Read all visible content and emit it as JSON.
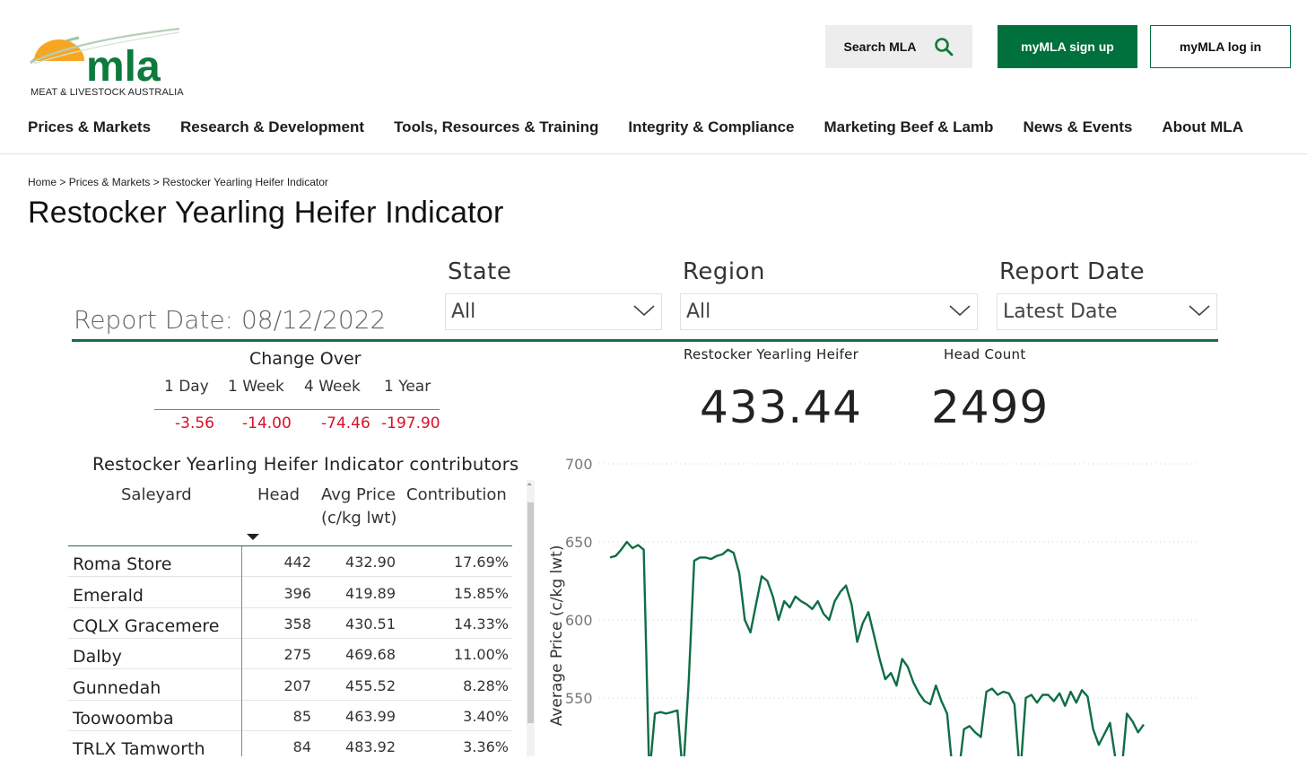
{
  "header": {
    "logo_text": "mla",
    "logo_tagline": "MEAT & LIVESTOCK AUSTRALIA",
    "search_label": "Search MLA",
    "signup_label": "myMLA sign up",
    "login_label": "myMLA log in",
    "colors": {
      "brand_green": "#00703c",
      "logo_orange": "#f6a623"
    }
  },
  "nav": {
    "items": [
      "Prices & Markets",
      "Research & Development",
      "Tools, Resources & Training",
      "Integrity & Compliance",
      "Marketing Beef & Lamb",
      "News & Events",
      "About MLA"
    ]
  },
  "breadcrumb": {
    "home": "Home",
    "sep": ">",
    "section": "Prices & Markets",
    "current": "Restocker Yearling Heifer Indicator"
  },
  "page_title": "Restocker Yearling Heifer Indicator",
  "report": {
    "report_date": "Report Date: 08/12/2022",
    "filters": [
      {
        "label": "State",
        "value": "All"
      },
      {
        "label": "Region",
        "value": "All"
      },
      {
        "label": "Report Date",
        "value": "Latest Date"
      }
    ],
    "change": {
      "title": "Change Over",
      "periods": [
        "1 Day",
        "1 Week",
        "4 Week",
        "1 Year"
      ],
      "values": [
        "-3.56",
        "-14.00",
        "-74.46",
        "-197.90"
      ],
      "negative_color": "#d8102a"
    },
    "kpis": [
      {
        "label": "Restocker Yearling Heifer",
        "value": "433.44"
      },
      {
        "label": "Head Count",
        "value": "2499"
      }
    ]
  },
  "contributors": {
    "title": "Restocker Yearling Heifer Indicator contributors",
    "columns": [
      "Saleyard",
      "Head",
      "Avg Price",
      "(c/kg lwt)",
      "Contribution"
    ],
    "rows": [
      [
        "Roma Store",
        "442",
        "432.90",
        "17.69%"
      ],
      [
        "Emerald",
        "396",
        "419.89",
        "15.85%"
      ],
      [
        "CQLX Gracemere",
        "358",
        "430.51",
        "14.33%"
      ],
      [
        "Dalby",
        "275",
        "469.68",
        "11.00%"
      ],
      [
        "Gunnedah",
        "207",
        "455.52",
        "8.28%"
      ],
      [
        "Toowoomba",
        "85",
        "463.99",
        "3.40%"
      ],
      [
        "TRLX Tamworth",
        "84",
        "483.92",
        "3.36%"
      ]
    ]
  },
  "chart_data": {
    "type": "line",
    "ylabel": "Average Price (c/kg lwt)",
    "y_ticks": [
      "700",
      "650",
      "600",
      "550"
    ],
    "ylim": [
      495,
      700
    ],
    "grid": true,
    "line_color": "#0f6e44",
    "series": [
      {
        "x": [
          0,
          2,
          4,
          6,
          8,
          10,
          12,
          14,
          16,
          18,
          20,
          22,
          24,
          26,
          28,
          30,
          32,
          34,
          36,
          38,
          40,
          42,
          44,
          46,
          48,
          50,
          52,
          54,
          56,
          58,
          60,
          62,
          64,
          66,
          68,
          70,
          72,
          74,
          76,
          78,
          80,
          82,
          84,
          86,
          88,
          90,
          92,
          94,
          96,
          98,
          100,
          102,
          104,
          106,
          108,
          110,
          112,
          114,
          116,
          118,
          120,
          122,
          124,
          126,
          128,
          130,
          132,
          134,
          136,
          138,
          140,
          142,
          144,
          146,
          148,
          150,
          152,
          154,
          156,
          158,
          160,
          162,
          164,
          166,
          168,
          170,
          172,
          174,
          176,
          178,
          180,
          182,
          184,
          186,
          188,
          190
        ],
        "y": [
          640,
          641,
          645,
          650,
          646,
          648,
          645,
          500,
          540,
          541,
          540,
          541,
          542,
          500,
          560,
          638,
          640,
          640,
          639,
          641,
          642,
          645,
          643,
          630,
          600,
          592,
          610,
          628,
          625,
          615,
          600,
          612,
          608,
          615,
          612,
          610,
          607,
          612,
          604,
          600,
          612,
          618,
          622,
          610,
          586,
          598,
          605,
          590,
          575,
          562,
          566,
          558,
          575,
          570,
          560,
          553,
          548,
          546,
          558,
          548,
          540,
          502,
          500,
          530,
          532,
          528,
          525,
          554,
          556,
          552,
          554,
          553,
          546,
          500,
          550,
          552,
          547,
          552,
          552,
          548,
          553,
          545,
          554,
          547,
          555,
          551,
          530,
          520,
          527,
          534,
          510,
          500,
          540,
          535,
          528,
          533
        ]
      }
    ]
  }
}
